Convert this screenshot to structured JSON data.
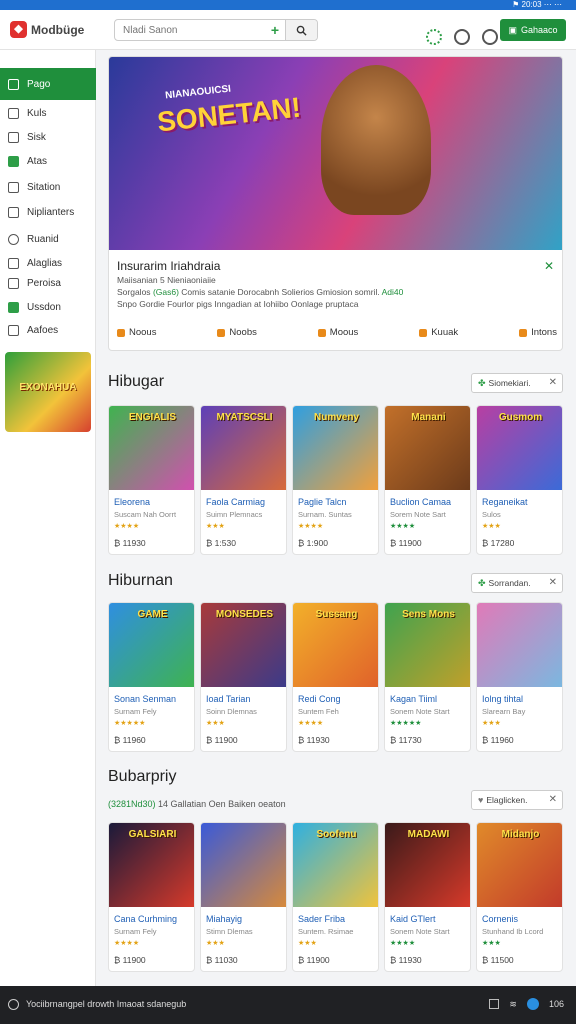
{
  "status_bar": {
    "text": "⚑ 20:03  ⋯ ⋯"
  },
  "header": {
    "logo_text": "Modbüge",
    "search_placeholder": "Nladi Sanon",
    "search_value": "",
    "sign_in_label": "Gahaaco"
  },
  "sidebar": {
    "items": [
      {
        "label": "Pago",
        "icon": "store-icon",
        "active": true
      },
      {
        "label": "Kuls",
        "icon": "grid-icon"
      },
      {
        "label": "Sisk",
        "icon": "link-icon"
      },
      {
        "label": "Atas",
        "icon": "phone-icon",
        "green": true
      },
      {
        "label": "Sitation",
        "icon": "book-icon"
      },
      {
        "label": "Niplianters",
        "icon": "pin-icon"
      },
      {
        "label": "Ruanid",
        "icon": "clock-icon"
      },
      {
        "label": "Alaglias",
        "icon": "chart-icon"
      },
      {
        "label": "Peroisa",
        "icon": "mail-icon"
      },
      {
        "label": "Ussdon",
        "icon": "check-icon",
        "green": true
      },
      {
        "label": "Aafoes",
        "icon": "home-icon"
      }
    ],
    "promo_text": "EXONAHUA"
  },
  "hero": {
    "banner_title": "SONETAN!",
    "banner_sub": "NIANAOUICSI",
    "info_title": "Insurarim Iriahdraia",
    "line1": "Maiisanian 5 Nieniaoniaiie",
    "line2_prefix": "Sorgalos",
    "line2_green1": "(Gas6)",
    "line2_mid": "Comis satanie Dorocabnh  Solierios Gmiosion somril.",
    "line2_green2": "Adi40",
    "line3": "Snpo Gordie Fourlor pigs Inngadian at Iohiibo Oonlage pruptaca",
    "tags": [
      "Noous",
      "Noobs",
      "Moous",
      "Kuuak",
      "Intons"
    ]
  },
  "sections": [
    {
      "title": "Hibugar",
      "filter": "Siomekiari.",
      "cards": [
        {
          "art": "ENGIALIS",
          "title": "Eleorena",
          "sub": "Suscam Nah Oorrt",
          "stars": "★★★★",
          "price": "₿ 11930",
          "colors": [
            "#3fb34f",
            "#d34fb0"
          ]
        },
        {
          "art": "MYATSCSLI",
          "title": "Faola Carmiag",
          "sub": "Suimn Plemnacs",
          "stars": "★★★",
          "price": "₿ 1:530",
          "colors": [
            "#5d3fb8",
            "#d86b3a"
          ]
        },
        {
          "art": "Numveny",
          "title": "Paglie Talcn",
          "sub": "Surnam. Suntas",
          "stars": "★★★★",
          "price": "₿ 1:900",
          "colors": [
            "#2f9fe0",
            "#f3a03a"
          ]
        },
        {
          "art": "Manani",
          "title": "Buclion Camaa",
          "sub": "Sorem Note Sart",
          "stars": "★★★★",
          "price": "₿ 11900",
          "colors": [
            "#c2702a",
            "#6b3a1a"
          ],
          "green_stars": true
        },
        {
          "art": "Gusmom",
          "title": "Reganeikat",
          "sub": "Sulos",
          "stars": "★★★",
          "price": "₿ 17280",
          "colors": [
            "#b83fa2",
            "#3a6bd8"
          ]
        }
      ]
    },
    {
      "title": "Hiburnan",
      "filter": "Sorrandan.",
      "cards": [
        {
          "art": "GAME",
          "title": "Sonan Senman",
          "sub": "Surnam Fely",
          "stars": "★★★★★",
          "price": "₿ 11960",
          "colors": [
            "#2f8fe0",
            "#3fb34f"
          ]
        },
        {
          "art": "MONSEDES",
          "title": "Ioad Tarian",
          "sub": "Soinn Dlemnas",
          "stars": "★★★",
          "price": "₿ 11900",
          "colors": [
            "#a83a3a",
            "#3a3a8a"
          ]
        },
        {
          "art": "Sussang",
          "title": "Redi Cong",
          "sub": "Suntem Feh",
          "stars": "★★★★",
          "price": "₿ 11930",
          "colors": [
            "#f2b02a",
            "#e0612a"
          ]
        },
        {
          "art": "Sens Mons",
          "title": "Kagan Tiiml",
          "sub": "Sonem Note Start",
          "stars": "★★★★★",
          "price": "₿ 11730",
          "colors": [
            "#3fa34f",
            "#c2a02a"
          ],
          "green_stars": true
        },
        {
          "art": "",
          "title": "Iolng tihtal",
          "sub": "Slarearn Bay",
          "stars": "★★★",
          "price": "₿ 11960",
          "colors": [
            "#e07ab8",
            "#7ab8e0"
          ]
        }
      ]
    },
    {
      "title": "Bubarpriy",
      "filter": "Elaglicken.",
      "desc_green": "(3281Nd30)",
      "desc": "14 Gallatian Oen Baiken oeaton",
      "cards": [
        {
          "art": "GALSIARI",
          "title": "Cana Curhming",
          "sub": "Surnam Fely",
          "stars": "★★★★",
          "price": "₿ 11900",
          "colors": [
            "#1a1a3a",
            "#d83a2a"
          ]
        },
        {
          "art": "",
          "title": "Miahayig",
          "sub": "Stimn Dlemas",
          "stars": "★★★",
          "price": "₿ 11030",
          "colors": [
            "#3a5ad8",
            "#d88a3a"
          ]
        },
        {
          "art": "Soofenu",
          "title": "Sader Friba",
          "sub": "Suntem. Rsimae",
          "stars": "★★★",
          "price": "₿ 11900",
          "colors": [
            "#2fb0e0",
            "#f2c33a"
          ]
        },
        {
          "art": "MADAWI",
          "title": "Kaid GTlert",
          "sub": "Sonem Note Start",
          "stars": "★★★★",
          "price": "₿ 11930",
          "colors": [
            "#3a1a1a",
            "#d83a2a"
          ],
          "green_stars": true
        },
        {
          "art": "Midanjo",
          "title": "Cornenis",
          "sub": "Stunhand Ib Lcord",
          "stars": "★★★",
          "price": "₿ 11500",
          "colors": [
            "#e08a2a",
            "#c23a2a"
          ],
          "green_stars": true
        }
      ]
    }
  ],
  "taskbar": {
    "text": "Yociibrnangpel drowth Imaoat sdanegub",
    "time": "106"
  }
}
